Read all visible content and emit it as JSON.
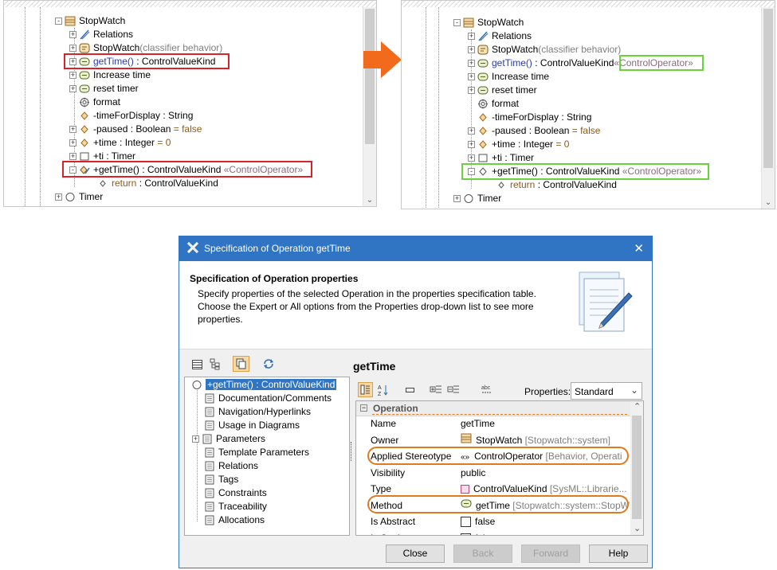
{
  "left_tree": {
    "rows": [
      {
        "name": "StopWatch"
      },
      {
        "name": "Relations"
      },
      {
        "name": "StopWatch",
        "extra": "(classifier behavior)"
      },
      {
        "name": "getTime()",
        "type": " : ControlValueKind"
      },
      {
        "name": "Increase time"
      },
      {
        "name": "reset timer"
      },
      {
        "name": "format"
      },
      {
        "name": "-timeForDisplay",
        "type": " : String"
      },
      {
        "name": "-paused",
        "type": " : Boolean",
        "value": " = false"
      },
      {
        "name": "+time",
        "type": " : Integer",
        "value": " = 0"
      },
      {
        "name": "+ti",
        "type": " : Timer"
      },
      {
        "name": "+getTime()",
        "type": " : ControlValueKind",
        "stereo": " «ControlOperator»"
      },
      {
        "name": "return",
        "type": "  : ControlValueKind"
      },
      {
        "name": "Timer"
      }
    ]
  },
  "right_tree": {
    "rows": [
      {
        "name": "StopWatch"
      },
      {
        "name": "Relations"
      },
      {
        "name": "StopWatch",
        "extra": "(classifier behavior)"
      },
      {
        "name": "getTime()",
        "type": " : ControlValueKind",
        "stereo": "«ControlOperator»"
      },
      {
        "name": "Increase time"
      },
      {
        "name": "reset timer"
      },
      {
        "name": "format"
      },
      {
        "name": "-timeForDisplay",
        "type": " : String"
      },
      {
        "name": "-paused",
        "type": " : Boolean",
        "value": " = false"
      },
      {
        "name": "+time",
        "type": " : Integer",
        "value": " = 0"
      },
      {
        "name": "+ti",
        "type": " : Timer"
      },
      {
        "name": "+getTime()",
        "type": " : ControlValueKind",
        "stereo": " «ControlOperator»"
      },
      {
        "name": "return",
        "type": "  : ControlValueKind"
      },
      {
        "name": "Timer"
      }
    ]
  },
  "dialog": {
    "title": "Specification of Operation getTime",
    "close_glyph": "✕",
    "header_title": "Specification of Operation properties",
    "header_desc_1": "Specify properties of the selected Operation in the properties specification table.",
    "header_desc_2": "Choose the Expert or All options from the Properties drop-down list to see more",
    "header_desc_3": "properties.",
    "nav_items": [
      {
        "label": "+getTime() : ControlValueKind",
        "selected": true
      },
      {
        "label": "Documentation/Comments"
      },
      {
        "label": "Navigation/Hyperlinks"
      },
      {
        "label": "Usage in Diagrams"
      },
      {
        "label": "Parameters",
        "expandable": true
      },
      {
        "label": "Template Parameters"
      },
      {
        "label": "Relations"
      },
      {
        "label": "Tags"
      },
      {
        "label": "Constraints"
      },
      {
        "label": "Traceability"
      },
      {
        "label": "Allocations"
      }
    ],
    "element_title": "getTime",
    "properties_label": "Properties:",
    "properties_value": "Standard",
    "group_label": "Operation",
    "props": [
      {
        "key": "Name",
        "value": "getTime"
      },
      {
        "key": "Owner",
        "value": "StopWatch",
        "dim": " [Stopwatch::system]"
      },
      {
        "key": "Applied Stereotype",
        "value": "ControlOperator",
        "dim": " [Behavior, Operati"
      },
      {
        "key": "Visibility",
        "value": "public"
      },
      {
        "key": "Type",
        "value": "ControlValueKind",
        "dim": " [SysML::Librarie..."
      },
      {
        "key": "Method",
        "value": "getTime",
        "dim": " [Stopwatch::system::StopW"
      },
      {
        "key": "Is Abstract",
        "value": "false"
      },
      {
        "key": "Is Static",
        "value": "false"
      }
    ],
    "buttons": {
      "close": "Close",
      "back": "Back",
      "forward": "Forward",
      "help": "Help"
    }
  },
  "colors": {
    "accent": "#2f75c4",
    "highlight_red": "#d9232b",
    "highlight_green": "#6ad23a",
    "highlight_orange": "#e07a1f",
    "arrow_orange": "#f26b1d"
  }
}
